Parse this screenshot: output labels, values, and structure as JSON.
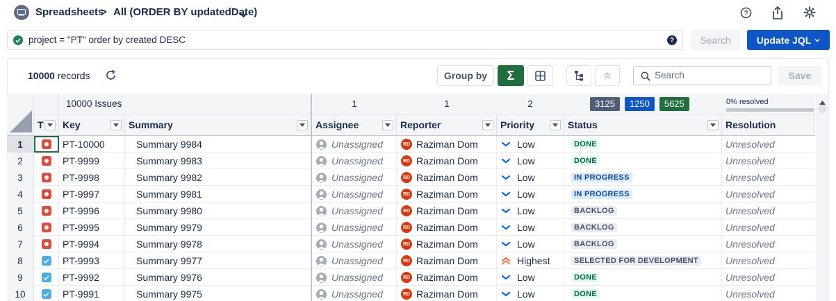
{
  "header": {
    "app_title": "Spreadsheets",
    "separator": ">",
    "view_name": "All (ORDER BY updatedDate)",
    "icons": [
      "help-icon",
      "share-icon",
      "gear-icon"
    ]
  },
  "jql": {
    "query": "project = \"PT\"  order by created DESC",
    "help_label": "?",
    "search_label": "Search",
    "update_label": "Update JQL"
  },
  "toolbar": {
    "records_count": "10000",
    "records_label": "records",
    "group_by_label": "Group by",
    "sigma_label": "Σ",
    "search_placeholder": "Search",
    "save_label": "Save"
  },
  "summary": {
    "issues_label": "10000 Issues",
    "assignee_count": "1",
    "reporter_count": "1",
    "priority_count": "2",
    "status_counts": [
      {
        "value": "3125",
        "color": "#505f79"
      },
      {
        "value": "1250",
        "color": "#0c56c7"
      },
      {
        "value": "5625",
        "color": "#1f6f3e"
      }
    ],
    "resolved_label": "0% resolved",
    "resolved_percent": 0
  },
  "columns": {
    "type": "T",
    "key": "Key",
    "summary": "Summary",
    "assignee": "Assignee",
    "reporter": "Reporter",
    "priority": "Priority",
    "status": "Status",
    "resolution": "Resolution"
  },
  "rows": [
    {
      "n": "1",
      "type": "bug",
      "key": "PT-10000",
      "summary": "Summary 9984",
      "assignee": "Unassigned",
      "reporter_initials": "RD",
      "reporter": "Raziman Dom",
      "priority": "Low",
      "status": "DONE",
      "status_kind": "done",
      "resolution": "Unresolved"
    },
    {
      "n": "2",
      "type": "bug",
      "key": "PT-9999",
      "summary": "Summary 9983",
      "assignee": "Unassigned",
      "reporter_initials": "RD",
      "reporter": "Raziman Dom",
      "priority": "Low",
      "status": "DONE",
      "status_kind": "done",
      "resolution": "Unresolved"
    },
    {
      "n": "3",
      "type": "bug",
      "key": "PT-9998",
      "summary": "Summary 9982",
      "assignee": "Unassigned",
      "reporter_initials": "RD",
      "reporter": "Raziman Dom",
      "priority": "Low",
      "status": "IN PROGRESS",
      "status_kind": "progress",
      "resolution": "Unresolved"
    },
    {
      "n": "4",
      "type": "bug",
      "key": "PT-9997",
      "summary": "Summary 9981",
      "assignee": "Unassigned",
      "reporter_initials": "RD",
      "reporter": "Raziman Dom",
      "priority": "Low",
      "status": "IN PROGRESS",
      "status_kind": "progress",
      "resolution": "Unresolved"
    },
    {
      "n": "5",
      "type": "bug",
      "key": "PT-9996",
      "summary": "Summary 9980",
      "assignee": "Unassigned",
      "reporter_initials": "RD",
      "reporter": "Raziman Dom",
      "priority": "Low",
      "status": "BACKLOG",
      "status_kind": "todo",
      "resolution": "Unresolved"
    },
    {
      "n": "6",
      "type": "bug",
      "key": "PT-9995",
      "summary": "Summary 9979",
      "assignee": "Unassigned",
      "reporter_initials": "RD",
      "reporter": "Raziman Dom",
      "priority": "Low",
      "status": "BACKLOG",
      "status_kind": "todo",
      "resolution": "Unresolved"
    },
    {
      "n": "7",
      "type": "bug",
      "key": "PT-9994",
      "summary": "Summary 9978",
      "assignee": "Unassigned",
      "reporter_initials": "RD",
      "reporter": "Raziman Dom",
      "priority": "Low",
      "status": "BACKLOG",
      "status_kind": "todo",
      "resolution": "Unresolved"
    },
    {
      "n": "8",
      "type": "task",
      "key": "PT-9993",
      "summary": "Summary 9977",
      "assignee": "Unassigned",
      "reporter_initials": "RD",
      "reporter": "Raziman Dom",
      "priority": "Highest",
      "status": "SELECTED FOR DEVELOPMENT",
      "status_kind": "todo",
      "resolution": "Unresolved"
    },
    {
      "n": "9",
      "type": "task",
      "key": "PT-9992",
      "summary": "Summary 9976",
      "assignee": "Unassigned",
      "reporter_initials": "RD",
      "reporter": "Raziman Dom",
      "priority": "Low",
      "status": "DONE",
      "status_kind": "done",
      "resolution": "Unresolved"
    },
    {
      "n": "10",
      "type": "task",
      "key": "PT-9991",
      "summary": "Summary 9975",
      "assignee": "Unassigned",
      "reporter_initials": "RD",
      "reporter": "Raziman Dom",
      "priority": "Low",
      "status": "DONE",
      "status_kind": "done",
      "resolution": "Unresolved"
    }
  ]
}
